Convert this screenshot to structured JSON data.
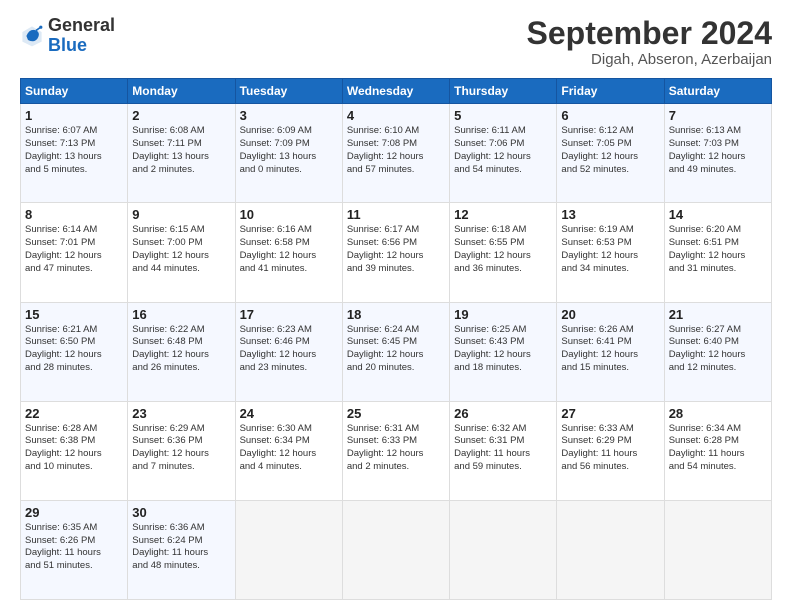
{
  "logo": {
    "general": "General",
    "blue": "Blue"
  },
  "header": {
    "month": "September 2024",
    "location": "Digah, Abseron, Azerbaijan"
  },
  "weekdays": [
    "Sunday",
    "Monday",
    "Tuesday",
    "Wednesday",
    "Thursday",
    "Friday",
    "Saturday"
  ],
  "weeks": [
    [
      {
        "day": "1",
        "info": "Sunrise: 6:07 AM\nSunset: 7:13 PM\nDaylight: 13 hours\nand 5 minutes."
      },
      {
        "day": "2",
        "info": "Sunrise: 6:08 AM\nSunset: 7:11 PM\nDaylight: 13 hours\nand 2 minutes."
      },
      {
        "day": "3",
        "info": "Sunrise: 6:09 AM\nSunset: 7:09 PM\nDaylight: 13 hours\nand 0 minutes."
      },
      {
        "day": "4",
        "info": "Sunrise: 6:10 AM\nSunset: 7:08 PM\nDaylight: 12 hours\nand 57 minutes."
      },
      {
        "day": "5",
        "info": "Sunrise: 6:11 AM\nSunset: 7:06 PM\nDaylight: 12 hours\nand 54 minutes."
      },
      {
        "day": "6",
        "info": "Sunrise: 6:12 AM\nSunset: 7:05 PM\nDaylight: 12 hours\nand 52 minutes."
      },
      {
        "day": "7",
        "info": "Sunrise: 6:13 AM\nSunset: 7:03 PM\nDaylight: 12 hours\nand 49 minutes."
      }
    ],
    [
      {
        "day": "8",
        "info": "Sunrise: 6:14 AM\nSunset: 7:01 PM\nDaylight: 12 hours\nand 47 minutes."
      },
      {
        "day": "9",
        "info": "Sunrise: 6:15 AM\nSunset: 7:00 PM\nDaylight: 12 hours\nand 44 minutes."
      },
      {
        "day": "10",
        "info": "Sunrise: 6:16 AM\nSunset: 6:58 PM\nDaylight: 12 hours\nand 41 minutes."
      },
      {
        "day": "11",
        "info": "Sunrise: 6:17 AM\nSunset: 6:56 PM\nDaylight: 12 hours\nand 39 minutes."
      },
      {
        "day": "12",
        "info": "Sunrise: 6:18 AM\nSunset: 6:55 PM\nDaylight: 12 hours\nand 36 minutes."
      },
      {
        "day": "13",
        "info": "Sunrise: 6:19 AM\nSunset: 6:53 PM\nDaylight: 12 hours\nand 34 minutes."
      },
      {
        "day": "14",
        "info": "Sunrise: 6:20 AM\nSunset: 6:51 PM\nDaylight: 12 hours\nand 31 minutes."
      }
    ],
    [
      {
        "day": "15",
        "info": "Sunrise: 6:21 AM\nSunset: 6:50 PM\nDaylight: 12 hours\nand 28 minutes."
      },
      {
        "day": "16",
        "info": "Sunrise: 6:22 AM\nSunset: 6:48 PM\nDaylight: 12 hours\nand 26 minutes."
      },
      {
        "day": "17",
        "info": "Sunrise: 6:23 AM\nSunset: 6:46 PM\nDaylight: 12 hours\nand 23 minutes."
      },
      {
        "day": "18",
        "info": "Sunrise: 6:24 AM\nSunset: 6:45 PM\nDaylight: 12 hours\nand 20 minutes."
      },
      {
        "day": "19",
        "info": "Sunrise: 6:25 AM\nSunset: 6:43 PM\nDaylight: 12 hours\nand 18 minutes."
      },
      {
        "day": "20",
        "info": "Sunrise: 6:26 AM\nSunset: 6:41 PM\nDaylight: 12 hours\nand 15 minutes."
      },
      {
        "day": "21",
        "info": "Sunrise: 6:27 AM\nSunset: 6:40 PM\nDaylight: 12 hours\nand 12 minutes."
      }
    ],
    [
      {
        "day": "22",
        "info": "Sunrise: 6:28 AM\nSunset: 6:38 PM\nDaylight: 12 hours\nand 10 minutes."
      },
      {
        "day": "23",
        "info": "Sunrise: 6:29 AM\nSunset: 6:36 PM\nDaylight: 12 hours\nand 7 minutes."
      },
      {
        "day": "24",
        "info": "Sunrise: 6:30 AM\nSunset: 6:34 PM\nDaylight: 12 hours\nand 4 minutes."
      },
      {
        "day": "25",
        "info": "Sunrise: 6:31 AM\nSunset: 6:33 PM\nDaylight: 12 hours\nand 2 minutes."
      },
      {
        "day": "26",
        "info": "Sunrise: 6:32 AM\nSunset: 6:31 PM\nDaylight: 11 hours\nand 59 minutes."
      },
      {
        "day": "27",
        "info": "Sunrise: 6:33 AM\nSunset: 6:29 PM\nDaylight: 11 hours\nand 56 minutes."
      },
      {
        "day": "28",
        "info": "Sunrise: 6:34 AM\nSunset: 6:28 PM\nDaylight: 11 hours\nand 54 minutes."
      }
    ],
    [
      {
        "day": "29",
        "info": "Sunrise: 6:35 AM\nSunset: 6:26 PM\nDaylight: 11 hours\nand 51 minutes."
      },
      {
        "day": "30",
        "info": "Sunrise: 6:36 AM\nSunset: 6:24 PM\nDaylight: 11 hours\nand 48 minutes."
      },
      {
        "day": "",
        "info": ""
      },
      {
        "day": "",
        "info": ""
      },
      {
        "day": "",
        "info": ""
      },
      {
        "day": "",
        "info": ""
      },
      {
        "day": "",
        "info": ""
      }
    ]
  ]
}
